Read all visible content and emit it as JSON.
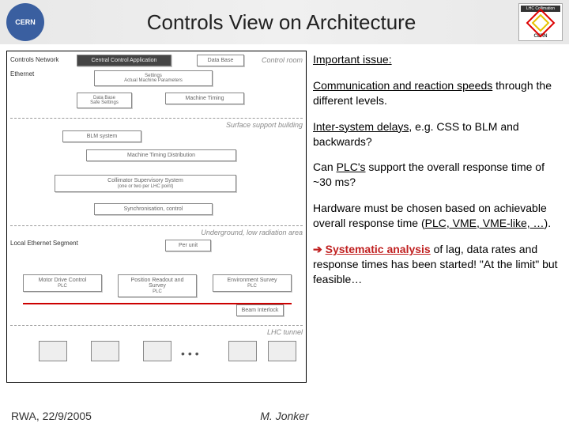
{
  "header": {
    "title": "Controls View on Architecture",
    "logo_left_label": "CERN",
    "logo_right_top": "LHC Collimation",
    "logo_right_bottom": "CERN"
  },
  "diagram": {
    "row_labels": {
      "controls_network": "Controls Network",
      "ethernet": "Ethernet",
      "local_ethernet": "Local Ethernet Segment"
    },
    "right_labels": {
      "control_room": "Control room",
      "surface": "Surface support building",
      "underground": "Underground, low radiation area",
      "tunnel": "LHC tunnel"
    },
    "nodes": {
      "central_app": "Central Control Application",
      "settings": "Settings",
      "actual_params": "Actual Machine Parameters",
      "data_base_top": "Data Base",
      "data_base": "Data Base",
      "safe_settings": "Safe Settings",
      "machine_timing": "Machine Timing",
      "blm": "BLM system",
      "timing_dist": "Machine Timing Distribution",
      "css": "Collimator Supervisory System",
      "css_sub": "(one or two per LHC point)",
      "sync": "Synchronisation, control",
      "per_unit": "Per unit",
      "motor": "Motor Drive Control",
      "plc1": "PLC",
      "position": "Position Readout and Survey",
      "plc2": "PLC",
      "env": "Environment Survey",
      "plc3": "PLC",
      "beam_interlock": "Beam Interlock"
    }
  },
  "text": {
    "p1_u": "Important issue:",
    "p2_a": "Communication and reaction speeds",
    "p2_b": " through the different levels.",
    "p3_a": "Inter-system delays",
    "p3_b": ", e.g. CSS to BLM and backwards?",
    "p4_a": "Can ",
    "p4_b": "PLC's",
    "p4_c": " support the overall response time of ~30 ms?",
    "p5_a": "Hardware must be chosen based on achievable overall response time (",
    "p5_b": "PLC, VME, VME-like, …",
    "p5_c": ").",
    "p6_arrow": "➔",
    "p6_red": "Systematic analysis",
    "p6_rest": " of lag, data rates and response times has been started! \"At the limit\" but feasible…"
  },
  "footer": {
    "left": "RWA, 22/9/2005",
    "center": "M. Jonker"
  }
}
